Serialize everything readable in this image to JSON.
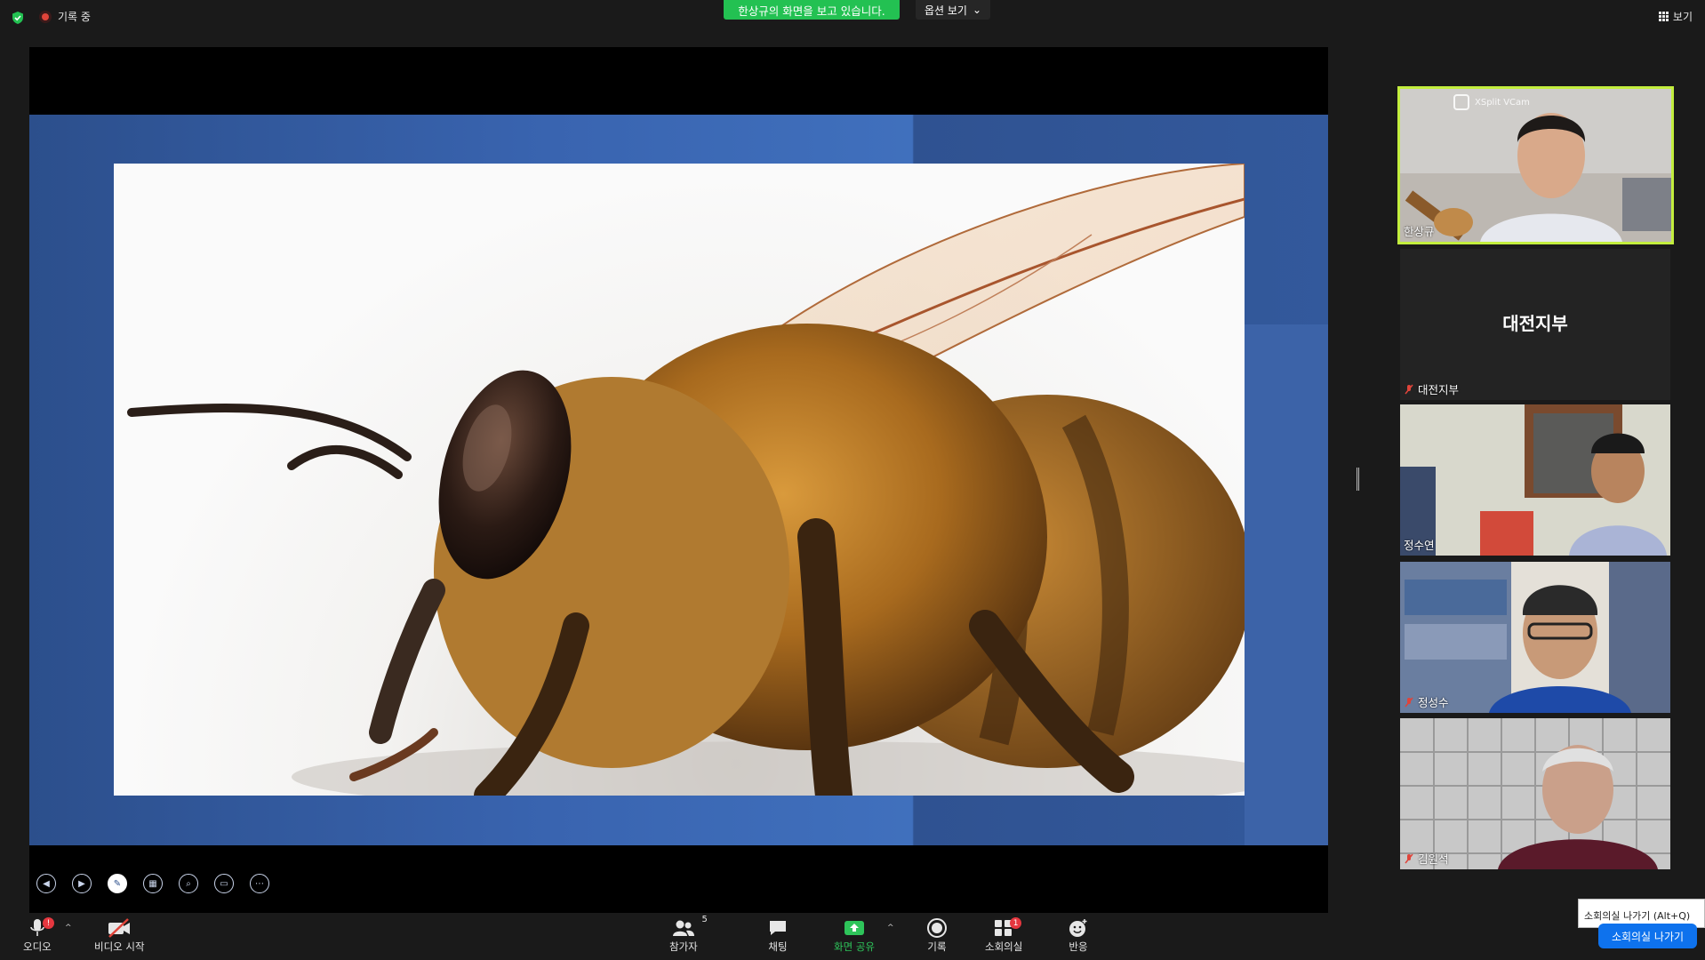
{
  "topbar": {
    "recording_label": "기록 중",
    "viewing_banner": "한상규의 화면을 보고 있습니다.",
    "view_options_label": "옵션 보기",
    "view_label": "보기"
  },
  "presentation": {
    "controls": [
      "prev-slide",
      "next-slide",
      "pen",
      "slides",
      "zoom",
      "subtitles",
      "more"
    ]
  },
  "participants": [
    {
      "name": "한상규",
      "overlay": "XSplit VCam",
      "active_speaker": true,
      "muted": false
    },
    {
      "name": "대전지부",
      "display_center": "대전지부",
      "video": false,
      "muted": true
    },
    {
      "name": "정수연",
      "muted": false
    },
    {
      "name": "정성수",
      "muted": true
    },
    {
      "name": "김원석",
      "muted": true
    }
  ],
  "toolbar": {
    "audio_label": "오디오",
    "video_label": "비디오 시작",
    "participants_label": "참가자",
    "participants_count": "5",
    "chat_label": "채팅",
    "share_label": "화면 공유",
    "record_label": "기록",
    "breakout_label": "소회의실",
    "breakout_badge": "1",
    "audio_badge": "!",
    "reactions_label": "반응",
    "leave_tooltip": "소회의실 나가기 (Alt+Q)",
    "leave_button": "소회의실 나가기"
  },
  "colors": {
    "share_banner": "#23c152",
    "active_speaker_border": "#c3ee3e",
    "leave_button": "#0e72ed",
    "badge": "#e5373f"
  }
}
